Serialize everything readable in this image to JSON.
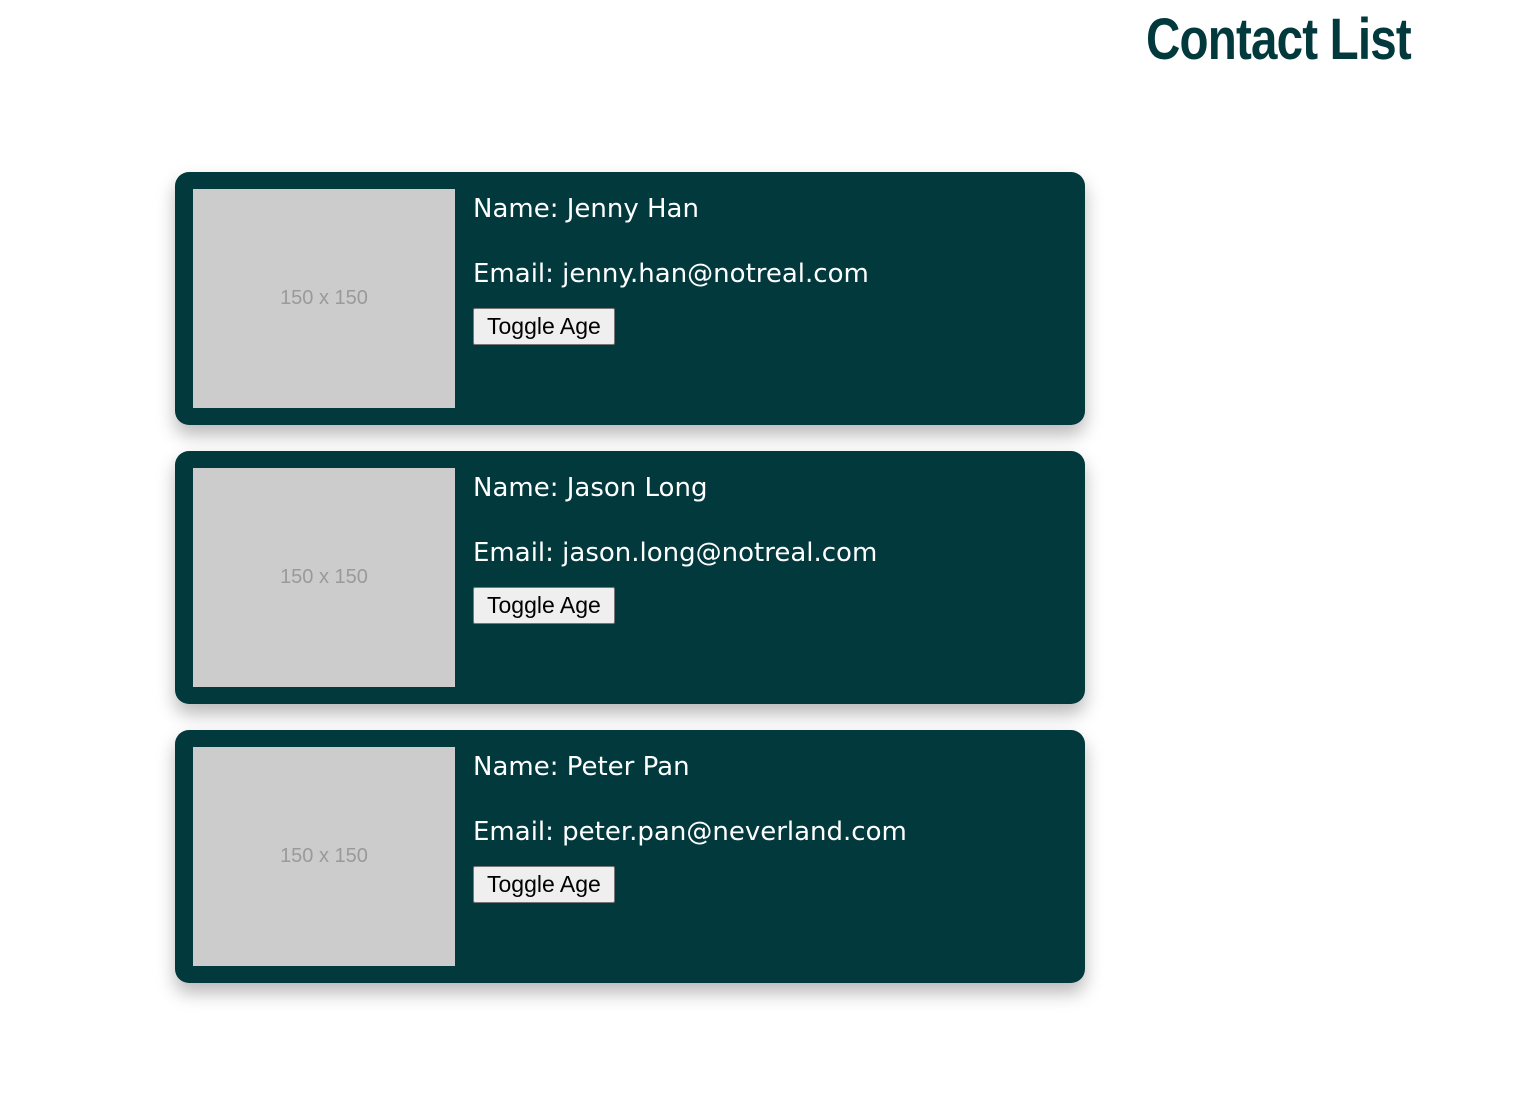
{
  "page": {
    "title": "Contact List"
  },
  "contacts": [
    {
      "avatar_placeholder": "150 x 150",
      "name_label": "Name:",
      "name": "Jenny Han",
      "email_label": "Email:",
      "email": "jenny.han@notreal.com",
      "toggle_label": "Toggle Age"
    },
    {
      "avatar_placeholder": "150 x 150",
      "name_label": "Name:",
      "name": "Jason Long",
      "email_label": "Email:",
      "email": "jason.long@notreal.com",
      "toggle_label": "Toggle Age"
    },
    {
      "avatar_placeholder": "150 x 150",
      "name_label": "Name:",
      "name": "Peter Pan",
      "email_label": "Email:",
      "email": "peter.pan@neverland.com",
      "toggle_label": "Toggle Age"
    }
  ],
  "colors": {
    "card_background": "#01393d",
    "title_color": "#01393d",
    "avatar_background": "#cccccc"
  }
}
